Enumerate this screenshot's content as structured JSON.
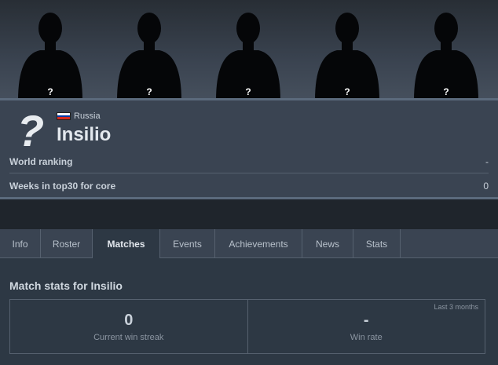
{
  "hero": {
    "players": [
      {
        "label": "?"
      },
      {
        "label": "?"
      },
      {
        "label": "?"
      },
      {
        "label": "?"
      },
      {
        "label": "?"
      }
    ]
  },
  "profile": {
    "country": "Russia",
    "team_name": "Insilio",
    "stats": [
      {
        "label": "World ranking",
        "value": "-"
      },
      {
        "label": "Weeks in top30 for core",
        "value": "0"
      }
    ]
  },
  "tabs": [
    {
      "label": "Info"
    },
    {
      "label": "Roster"
    },
    {
      "label": "Matches",
      "active": true
    },
    {
      "label": "Events"
    },
    {
      "label": "Achievements"
    },
    {
      "label": "News"
    },
    {
      "label": "Stats"
    }
  ],
  "match_stats": {
    "title": "Match stats for Insilio",
    "period": "Last 3 months",
    "win_streak": {
      "value": "0",
      "label": "Current win streak"
    },
    "win_rate": {
      "value": "-",
      "label": "Win rate"
    }
  },
  "colors": {
    "background": "#2d3844",
    "panel": "#3a4452",
    "dark_band": "#1f252c",
    "accent_line": "#5b6a7c"
  },
  "icons": {
    "player": "player-silhouette-icon",
    "team_logo": "question-mark-icon",
    "flag": "russia-flag-icon"
  }
}
